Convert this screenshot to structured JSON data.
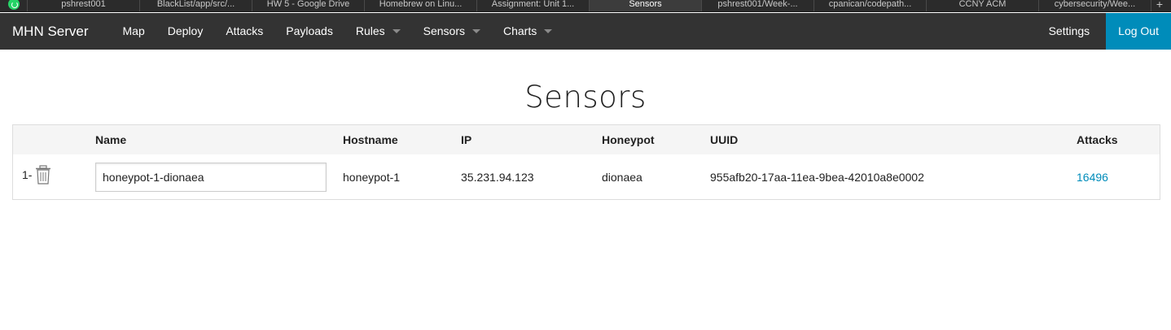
{
  "browser_tabs": [
    {
      "label": "pshrest001",
      "active": false
    },
    {
      "label": "BlackList/app/src/...",
      "active": false
    },
    {
      "label": "HW 5 - Google Drive",
      "active": false
    },
    {
      "label": "Homebrew on Linu...",
      "active": false
    },
    {
      "label": "Assignment: Unit 1...",
      "active": false
    },
    {
      "label": "Sensors",
      "active": true
    },
    {
      "label": "pshrest001/Week-...",
      "active": false
    },
    {
      "label": "cpanican/codepath...",
      "active": false
    },
    {
      "label": "CCNY ACM",
      "active": false
    },
    {
      "label": "cybersecurity/Wee...",
      "active": false
    }
  ],
  "tabstrip": {
    "new_tab": "+"
  },
  "navbar": {
    "brand": "MHN Server",
    "items": [
      {
        "label": "Map",
        "dropdown": false
      },
      {
        "label": "Deploy",
        "dropdown": false
      },
      {
        "label": "Attacks",
        "dropdown": false
      },
      {
        "label": "Payloads",
        "dropdown": false
      },
      {
        "label": "Rules",
        "dropdown": true
      },
      {
        "label": "Sensors",
        "dropdown": true
      },
      {
        "label": "Charts",
        "dropdown": true
      }
    ],
    "settings": "Settings",
    "logout": "Log Out"
  },
  "page": {
    "title": "Sensors"
  },
  "table": {
    "headers": {
      "name": "Name",
      "hostname": "Hostname",
      "ip": "IP",
      "honeypot": "Honeypot",
      "uuid": "UUID",
      "attacks": "Attacks"
    },
    "rows": [
      {
        "index": "1-",
        "name": "honeypot-1-dionaea",
        "hostname": "honeypot-1",
        "ip": "35.231.94.123",
        "honeypot": "dionaea",
        "uuid": "955afb20-17aa-11ea-9bea-42010a8e0002",
        "attacks": "16496"
      }
    ]
  },
  "colors": {
    "navbar_bg": "#333333",
    "accent": "#008cba",
    "header_row_bg": "#f5f5f5"
  }
}
